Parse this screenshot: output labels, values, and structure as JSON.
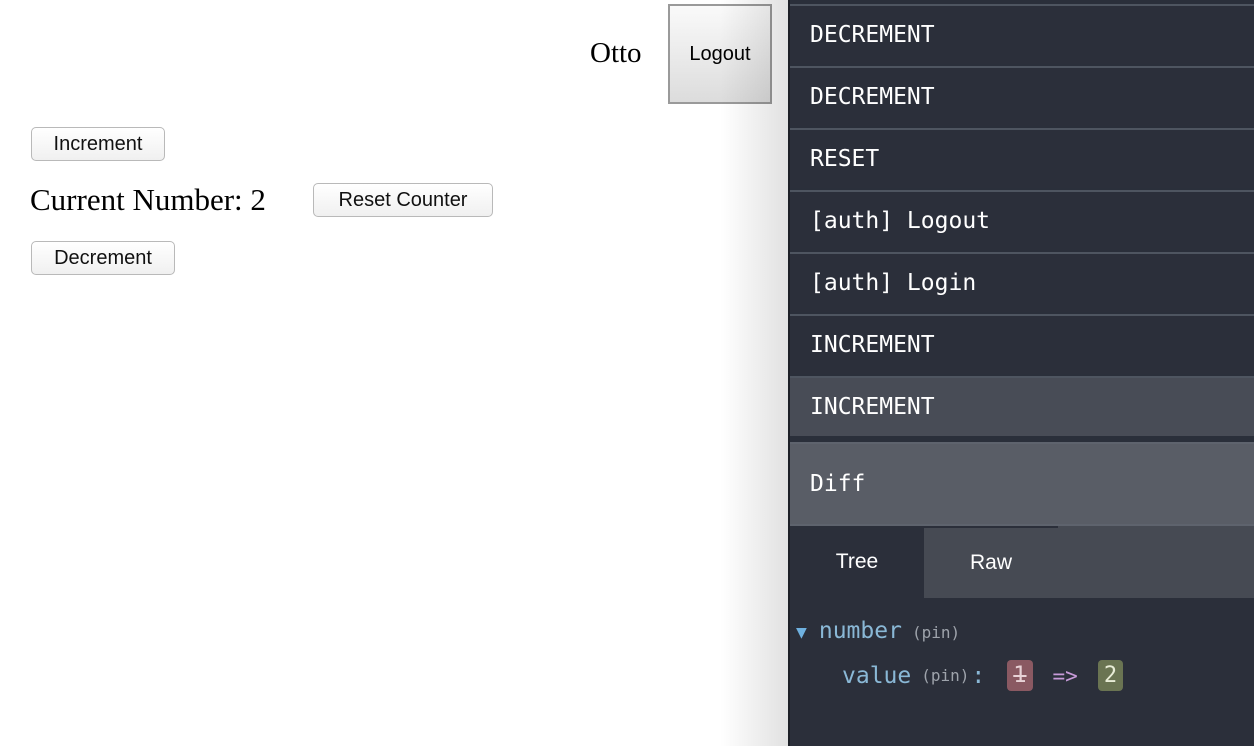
{
  "app": {
    "user_name": "Otto",
    "logout_label": "Logout",
    "increment_label": "Increment",
    "current_number_label": "Current Number: 2",
    "reset_label": "Reset Counter",
    "decrement_label": "Decrement"
  },
  "devtools": {
    "actions": [
      {
        "label": "DECREMENT",
        "selected": false
      },
      {
        "label": "DECREMENT",
        "selected": false
      },
      {
        "label": "RESET",
        "selected": false
      },
      {
        "label": "[auth] Logout",
        "selected": false
      },
      {
        "label": "[auth] Login",
        "selected": false
      },
      {
        "label": "INCREMENT",
        "selected": false
      },
      {
        "label": "INCREMENT",
        "selected": true
      }
    ],
    "monitor_tab": "Diff",
    "subtabs": {
      "tree": "Tree",
      "raw": "Raw",
      "active": "Tree"
    },
    "diff": {
      "key": "number",
      "key_pin": "(pin)",
      "child_key": "value",
      "child_pin": "(pin)",
      "colon": ":",
      "old_value": "1",
      "arrow": "=>",
      "new_value": "2"
    },
    "colors": {
      "panel_bg": "#2b2f3a",
      "selected_bg": "#484c56",
      "old_value_bg": "#8a5962",
      "new_value_bg": "#6a7452",
      "key": "#8ab8d6"
    }
  }
}
